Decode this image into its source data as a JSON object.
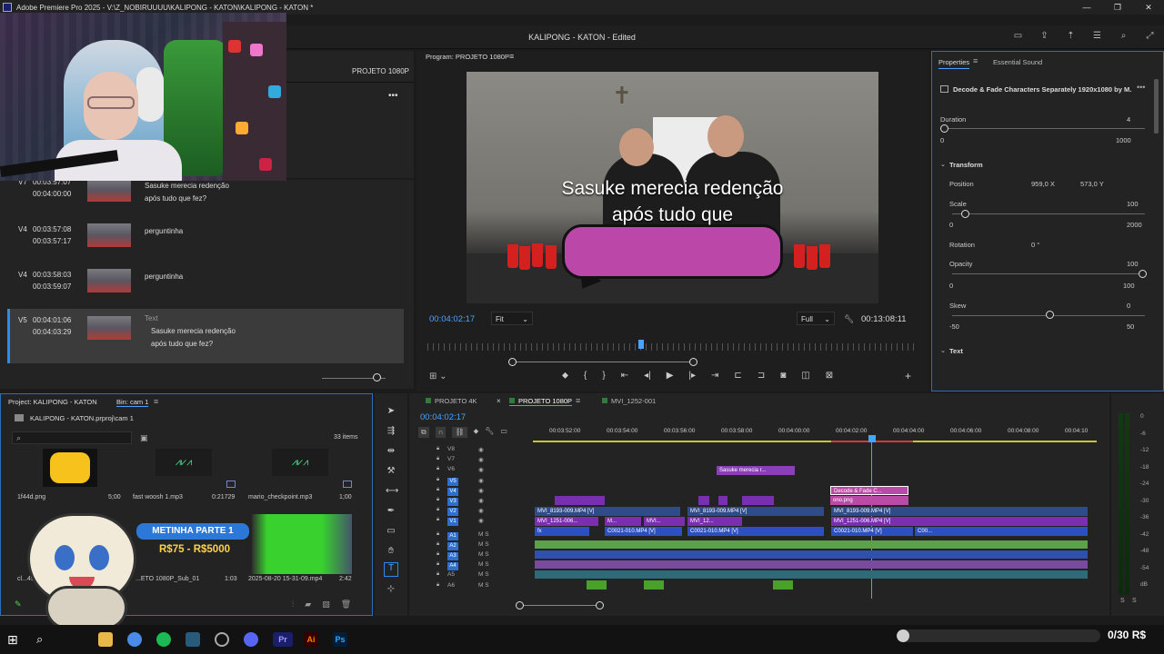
{
  "window": {
    "title": "Adobe Premiere Pro 2025 - V:\\Z_NOBIRUUUU\\KALIPONG - KATON\\KALIPONG - KATON *",
    "project_title": "KALIPONG - KATON - Edited",
    "controls": [
      "—",
      "❐",
      "✕"
    ]
  },
  "source_panel": {
    "sequence_label": "PROJETO 1080P",
    "menu": "•••",
    "captions": [
      {
        "track": "V7",
        "in": "00:03:57:07",
        "out": "00:04:00:00",
        "text": [
          "Sasuke merecia redenção",
          "após tudo que fez?"
        ]
      },
      {
        "track": "V4",
        "in": "00:03:57:08",
        "out": "00:03:57:17",
        "text": [
          "perguntinha"
        ]
      },
      {
        "track": "V4",
        "in": "00:03:58:03",
        "out": "00:03:59:07",
        "text": [
          "perguntinha"
        ]
      },
      {
        "track": "V5",
        "in": "00:04:01:06",
        "out": "00:04:03:29",
        "type": "Text",
        "text": [
          "Sasuke merecia redenção",
          "após tudo que fez?"
        ],
        "selected": true
      }
    ]
  },
  "program": {
    "tab": "Program: PROJETO 1080P",
    "subtitle": [
      "Sasuke merecia redenção",
      "após tudo que"
    ],
    "timecode": "00:04:02:17",
    "fit": "Fit",
    "quality": "Full",
    "duration": "00:13:08:11",
    "playhead_fraction": 0.43
  },
  "properties": {
    "tabs": [
      "Properties",
      "Essential Sound"
    ],
    "clip_name": "Decode & Fade Characters Separately 1920x1080 by M...",
    "duration": {
      "label": "Duration",
      "value": "4",
      "min": "0",
      "max": "1000"
    },
    "transform_label": "Transform",
    "position": {
      "label": "Position",
      "x": "959,0 X",
      "y": "573,0 Y"
    },
    "scale": {
      "label": "Scale",
      "value": "100",
      "min": "0",
      "max": "2000",
      "fraction": 0.05
    },
    "rotation": {
      "label": "Rotation",
      "value": "0 °"
    },
    "opacity": {
      "label": "Opacity",
      "value": "100",
      "min": "0",
      "max": "100",
      "fraction": 1.0
    },
    "skew": {
      "label": "Skew",
      "value": "0",
      "min": "-50",
      "max": "50",
      "fraction": 0.5
    },
    "text_label": "Text"
  },
  "project": {
    "tab": "Project: KALIPONG - KATON",
    "bin": "Bin: cam 1",
    "path": "KALIPONG - KATON.prproj\\cam 1",
    "items_count": "33 items",
    "items": [
      {
        "name": "1f44d.png",
        "dur": "5;00"
      },
      {
        "name": "fast woosh 1.mp3",
        "dur": "0:21729"
      },
      {
        "name": "mario_checkpoint.mp3",
        "dur": "1;00"
      },
      {
        "name": "cl...4968.png",
        "dur": ""
      },
      {
        "name": "...ETO 1080P_Sub_01",
        "dur": "1:03"
      },
      {
        "name": "2025-08-20 15-31-09.mp4",
        "dur": "2:42"
      }
    ],
    "promo": {
      "title": "METINHA PARTE 1",
      "price": "R$75 - R$5000"
    }
  },
  "timeline": {
    "tabs": [
      "PROJETO 4K",
      "PROJETO 1080P",
      "MVI_1252-001"
    ],
    "timecode": "00:04:02:17",
    "ruler": [
      "00:03:52:00",
      "00:03:54:00",
      "00:03:56:00",
      "00:03:58:00",
      "00:04:00:00",
      "00:04:02:00",
      "00:04:04:00",
      "00:04:06:00",
      "00:04:08:00",
      "00:04:10"
    ],
    "video_tracks": [
      "V8",
      "V7",
      "V6",
      "V5",
      "V4",
      "V3",
      "V2",
      "V1"
    ],
    "audio_tracks": [
      "A1",
      "A2",
      "A3",
      "A4",
      "A5",
      "A6"
    ],
    "clips": {
      "v7": "Sasuke merecia r...",
      "v5": "Decode & Fade C...",
      "v4": "ono.png",
      "v3a": "MVI_8193-009.MP4 [V]",
      "v3b": "MVI_8193-009.MP4 [V]",
      "v3c": "MVI_8193-009.MP4 [V]",
      "v2a": "MVI_1251-006...",
      "v2b": "M...",
      "v2c": "MVI...",
      "v2d": "MVI_12...",
      "v2e": "MVI_1251-006.MP4 [V]",
      "v1a": "C0021-010.MP4 [V]",
      "v1b": "C0021-010.MP4 [V]",
      "v1c": "C0021-010.MP4 [V]",
      "v1d": "C00...",
      "fx": "fx"
    }
  },
  "meters": {
    "scale": [
      "0",
      "-6",
      "-12",
      "-18",
      "-24",
      "-30",
      "-36",
      "-42",
      "-48",
      "-54",
      "dB"
    ],
    "solo": [
      "S",
      "S"
    ]
  },
  "overlay": {
    "goal": "0/30 R$",
    "goal_fraction": 0.0
  },
  "colors": {
    "accent": "#4aa3ff",
    "clip_purple": "#7a2fb0",
    "clip_blue": "#2f4fc0",
    "audio_green": "#5aa14a",
    "bubble": "#bb47a8"
  }
}
